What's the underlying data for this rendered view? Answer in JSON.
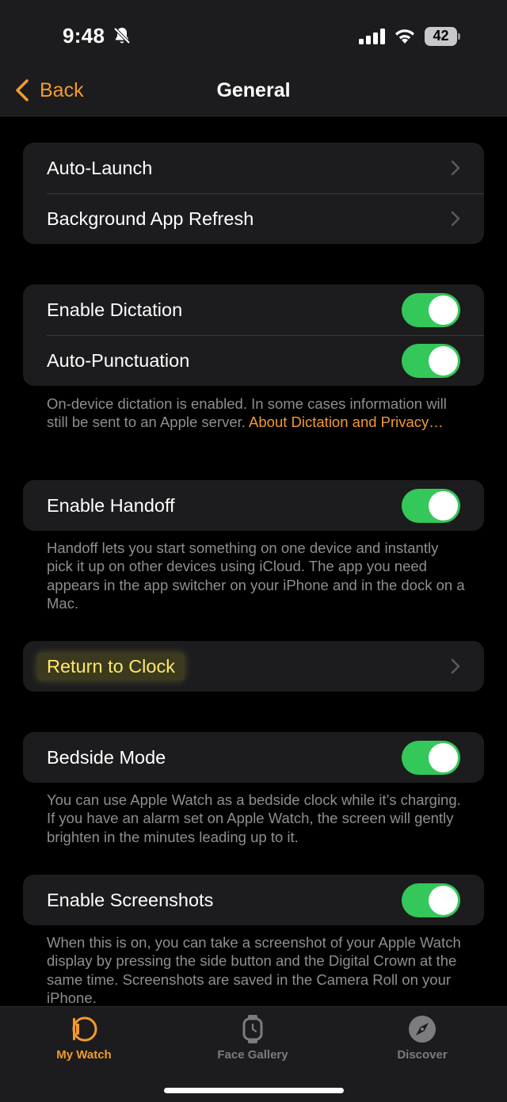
{
  "status": {
    "time": "9:48",
    "battery": "42"
  },
  "nav": {
    "back_label": "Back",
    "title": "General"
  },
  "groups": {
    "launch": {
      "auto_launch": "Auto-Launch",
      "background_refresh": "Background App Refresh"
    },
    "dictation": {
      "enable_dictation": "Enable Dictation",
      "auto_punctuation": "Auto-Punctuation",
      "footer_text": "On-device dictation is enabled. In some cases information will still be sent to an Apple server. ",
      "footer_link": "About Dictation and Privacy…"
    },
    "handoff": {
      "enable_handoff": "Enable Handoff",
      "footer": "Handoff lets you start something on one device and instantly pick it up on other devices using iCloud. The app you need appears in the app switcher on your iPhone and in the dock on a Mac."
    },
    "clock": {
      "return_to_clock": "Return to Clock"
    },
    "bedside": {
      "bedside_mode": "Bedside Mode",
      "footer": "You can use Apple Watch as a bedside clock while it’s charging. If you have an alarm set on Apple Watch, the screen will gently brighten in the minutes leading up to it."
    },
    "screenshots": {
      "enable_screenshots": "Enable Screenshots",
      "footer": "When this is on, you can take a screenshot of your Apple Watch display by pressing the side button and the Digital Crown at the same time. Screenshots are saved in the Camera Roll on your iPhone."
    }
  },
  "toggles": {
    "enable_dictation": true,
    "auto_punctuation": true,
    "enable_handoff": true,
    "bedside_mode": true,
    "enable_screenshots": true
  },
  "tabs": [
    {
      "label": "My Watch",
      "icon": "watch-icon",
      "active": true
    },
    {
      "label": "Face Gallery",
      "icon": "watch-face-icon",
      "active": false
    },
    {
      "label": "Discover",
      "icon": "compass-icon",
      "active": false
    }
  ],
  "colors": {
    "accent": "#f29a2e",
    "toggle_on": "#34c759",
    "cell_bg": "#1c1c1e",
    "highlight_text": "#ffe66b"
  }
}
